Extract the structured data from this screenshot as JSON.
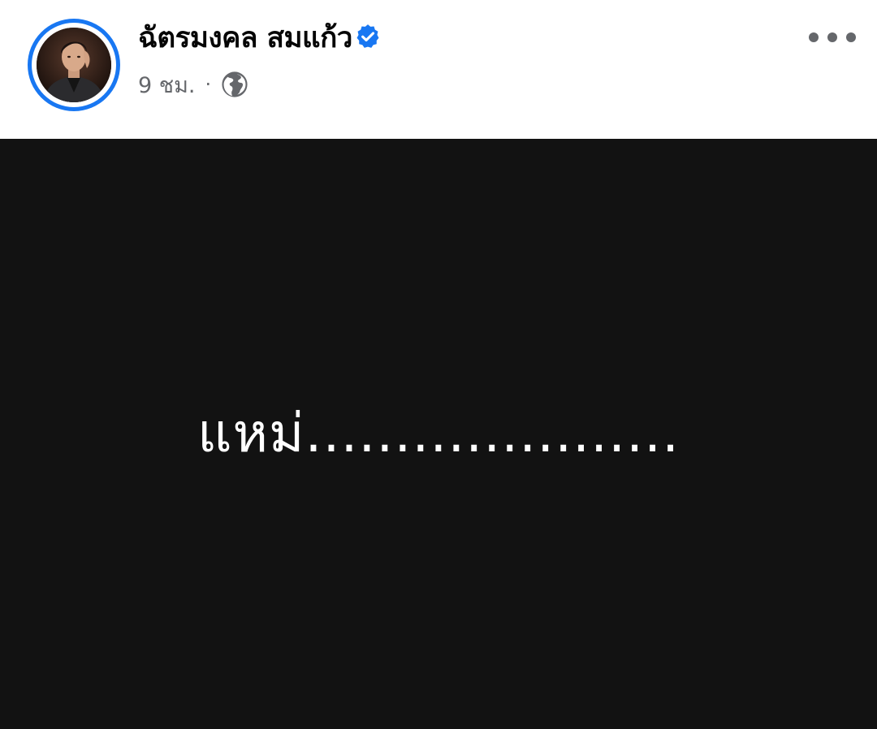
{
  "post": {
    "author": {
      "name": "ฉัตรมงคล สมแก้ว",
      "verified_icon": "verified-badge-icon",
      "avatar_ring_color": "#1877f2"
    },
    "meta": {
      "time": "9 ชม.",
      "separator": "·",
      "audience_icon": "globe-icon"
    },
    "menu_icon": "more-options-icon",
    "content": {
      "text": "แหม่.....................",
      "background_color": "#121212",
      "text_color": "#ffffff"
    }
  }
}
